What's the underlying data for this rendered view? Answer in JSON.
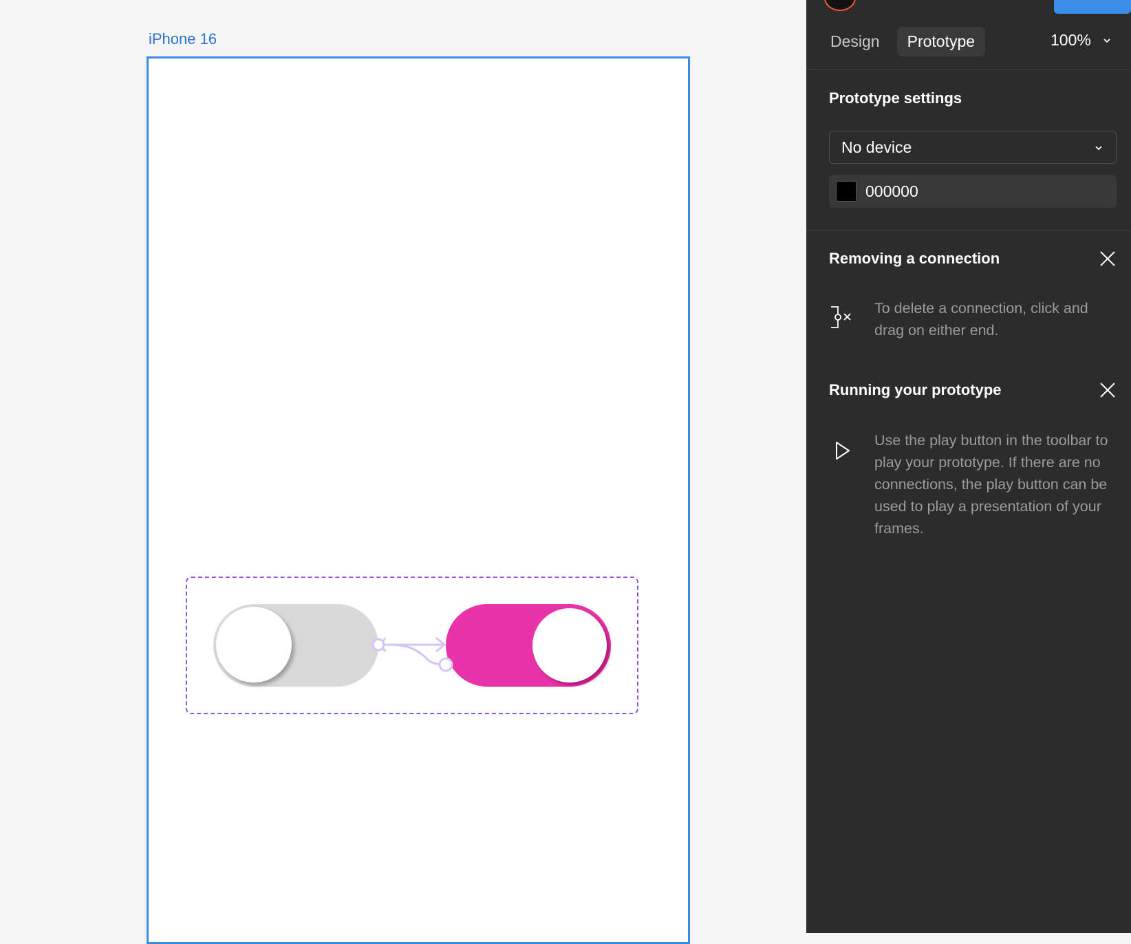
{
  "canvas": {
    "frame_label": "iPhone 16"
  },
  "toggles": {
    "off_color": "#d9d9d9",
    "on_color": "#e933a8",
    "connection_color": "#d4c4f7",
    "selection_color": "#8a52e8"
  },
  "panel": {
    "tabs": [
      {
        "label": "Design",
        "active": false
      },
      {
        "label": "Prototype",
        "active": true
      }
    ],
    "zoom": "100%",
    "prototype_settings": {
      "title": "Prototype settings",
      "device": "No device",
      "background_color": "000000"
    },
    "tips": [
      {
        "title": "Removing a connection",
        "text": "To delete a connection, click and drag on either end.",
        "icon": "remove-connection-icon"
      },
      {
        "title": "Running your prototype",
        "text": "Use the play button in the toolbar to play your prototype. If there are no connections, the play button can be used to play a presentation of your frames.",
        "icon": "play-icon"
      }
    ]
  },
  "colors": {
    "panel_bg": "#2c2c2c",
    "accent_blue": "#3d8ee8",
    "frame_border": "#3b8ae6"
  }
}
